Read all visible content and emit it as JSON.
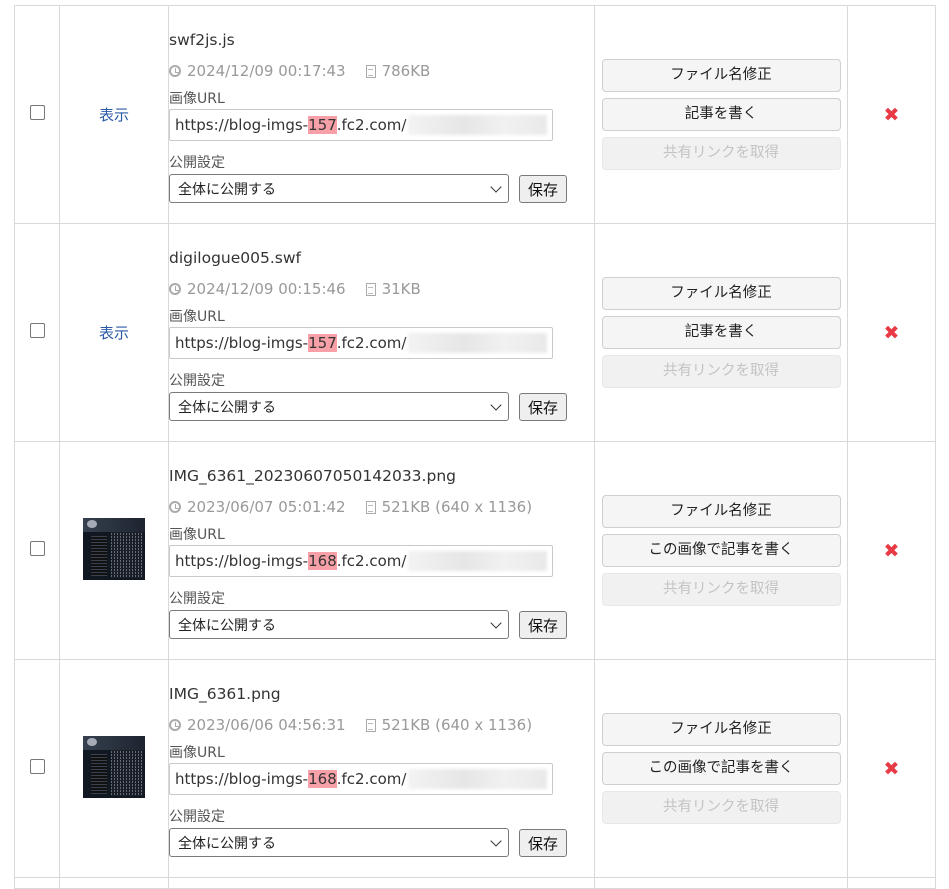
{
  "rows": [
    {
      "preview": {
        "type": "link",
        "label": "表示"
      },
      "filename": "swf2js.js",
      "date": "2024/12/09 00:17:43",
      "size": "786KB",
      "url_label": "画像URL",
      "url_prefix": "https://blog-imgs-",
      "url_server": "157",
      "url_suffix": ".fc2.com/",
      "pub_label": "公開設定",
      "pub_value": "全体に公開する",
      "save_label": "保存",
      "btn_rename": "ファイル名修正",
      "btn_write": "記事を書く",
      "btn_share": "共有リンクを取得"
    },
    {
      "preview": {
        "type": "link",
        "label": "表示"
      },
      "filename": "digilogue005.swf",
      "date": "2024/12/09 00:15:46",
      "size": "31KB",
      "url_label": "画像URL",
      "url_prefix": "https://blog-imgs-",
      "url_server": "157",
      "url_suffix": ".fc2.com/",
      "pub_label": "公開設定",
      "pub_value": "全体に公開する",
      "save_label": "保存",
      "btn_rename": "ファイル名修正",
      "btn_write": "記事を書く",
      "btn_share": "共有リンクを取得"
    },
    {
      "preview": {
        "type": "thumbnail"
      },
      "filename": "IMG_6361_20230607050142033.png",
      "date": "2023/06/07 05:01:42",
      "size": "521KB (640 x 1136)",
      "url_label": "画像URL",
      "url_prefix": "https://blog-imgs-",
      "url_server": "168",
      "url_suffix": ".fc2.com/",
      "pub_label": "公開設定",
      "pub_value": "全体に公開する",
      "save_label": "保存",
      "btn_rename": "ファイル名修正",
      "btn_write": "この画像で記事を書く",
      "btn_share": "共有リンクを取得"
    },
    {
      "preview": {
        "type": "thumbnail"
      },
      "filename": "IMG_6361.png",
      "date": "2023/06/06 04:56:31",
      "size": "521KB (640 x 1136)",
      "url_label": "画像URL",
      "url_prefix": "https://blog-imgs-",
      "url_server": "168",
      "url_suffix": ".fc2.com/",
      "pub_label": "公開設定",
      "pub_value": "全体に公開する",
      "save_label": "保存",
      "btn_rename": "ファイル名修正",
      "btn_write": "この画像で記事を書く",
      "btn_share": "共有リンクを取得"
    }
  ],
  "icons": {
    "delete": "close-x-icon",
    "date": "clock-icon",
    "size": "document-icon"
  },
  "colors": {
    "link": "#2b5aa8",
    "highlight": "#f7a0a8",
    "delete": "#e83a45"
  }
}
